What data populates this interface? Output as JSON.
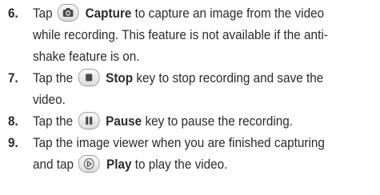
{
  "steps": [
    {
      "number": "6.",
      "before_icon": "Tap",
      "icon": "camera-icon",
      "label": "Capture",
      "line1_rest": "to capture an image from the video",
      "line2": "while recording. This feature is not available if the anti-",
      "line3": "shake feature is on."
    },
    {
      "number": "7.",
      "before_icon": "Tap the",
      "icon": "stop-icon",
      "label": "Stop",
      "line1_rest": "key to stop recording and save the",
      "line2": "video."
    },
    {
      "number": "8.",
      "before_icon": "Tap the",
      "icon": "pause-icon",
      "label": "Pause",
      "line1_rest": "key to pause the recording."
    },
    {
      "number": "9.",
      "line1": "Tap the image viewer when you are finished capturing",
      "before_icon": "and tap",
      "icon": "play-icon",
      "label": "Play",
      "line2_rest": "to play the video."
    }
  ]
}
